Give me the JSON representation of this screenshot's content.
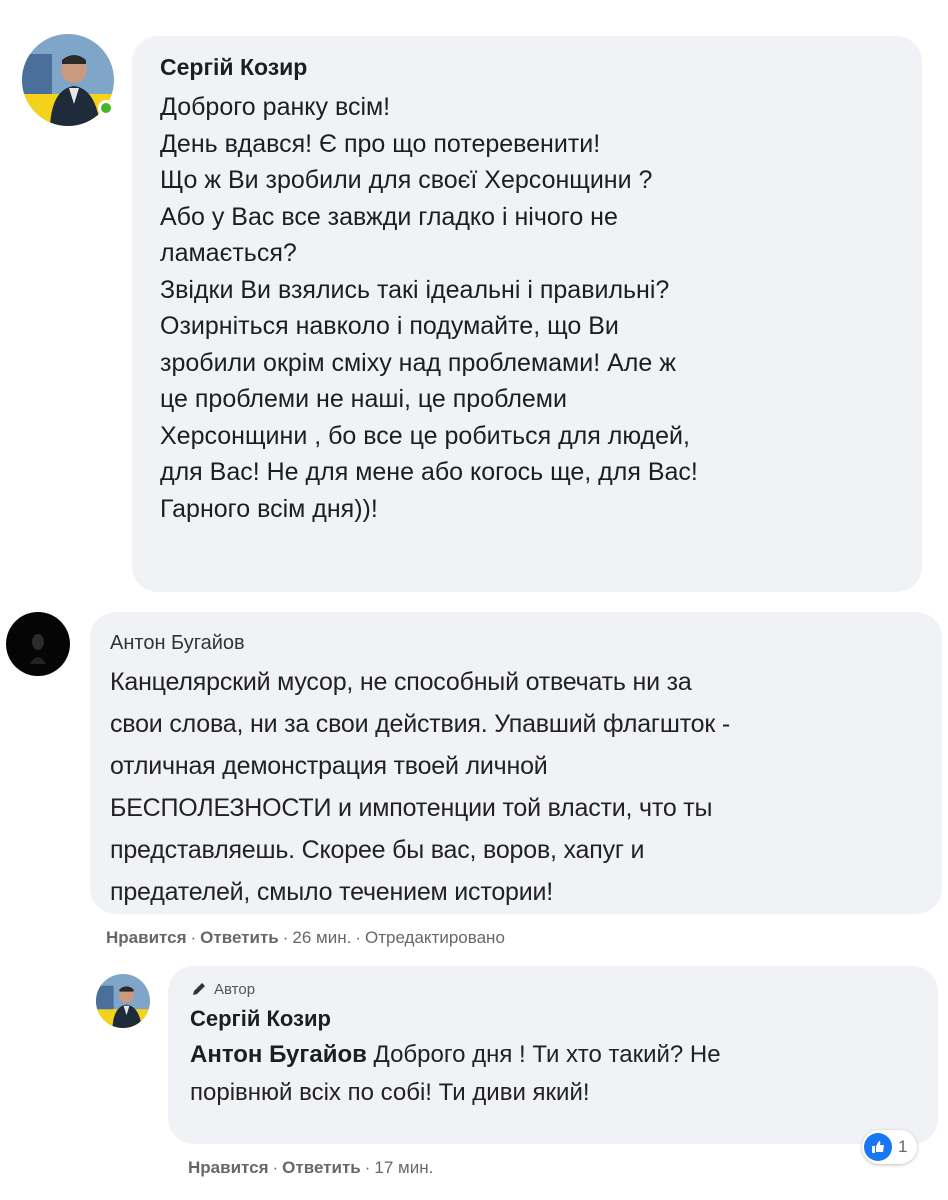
{
  "top_fragment": "",
  "comments": [
    {
      "author": "Сергій Козир",
      "online": true,
      "text": "Доброго ранку всім!\nДень вдався! Є про що потеревенити!\nЩо ж Ви зробили для своєї Херсонщини ?\nАбо у Вас все завжди гладко і нічого не\nламається?\nЗвідки Ви взялись такі ідеальні і правильні?\nОзирніться навколо і подумайте, що Ви\nзробили окрім сміху над проблемами! Але ж\nце проблеми не наші, це проблеми\nХерсонщини , бо все це робиться для людей,\nдля Вас! Не для мене або когось ще, для Вас!\nГарного всім дня))!"
    },
    {
      "author": "Антон Бугайов",
      "text": "Канцелярский мусор, не способный отвечать ни за\nсвои слова, ни за свои действия. Упавший флагшток -\nотличная демонстрация твоей личной\nБЕСПОЛЕЗНОСТИ и импотенции той власти, что ты\nпредставляешь. Скорее бы вас, воров, хапуг и\nпредателей, смыло течением истории!",
      "actions": {
        "like": "Нравится",
        "reply": "Ответить",
        "time": "26 мин.",
        "edited": "Отредактировано"
      }
    },
    {
      "badge": "Автор",
      "author": "Сергій Козир",
      "mention": "Антон Бугайов",
      "text_line1": " Доброго дня ! Ти хто такий? Не",
      "text_line2": "порівнюй всіх по собі! Ти диви який!",
      "reaction_count": "1",
      "actions": {
        "like": "Нравится",
        "reply": "Ответить",
        "time": "17 мин."
      }
    }
  ],
  "colors": {
    "bubble": "#f0f2f5",
    "online": "#42b72a",
    "like": "#1877f2",
    "meta_text": "#65676b"
  },
  "icons": [
    "avatar-kozyr",
    "online-dot",
    "avatar-buhaiov",
    "pen-icon",
    "like-reaction-icon"
  ]
}
